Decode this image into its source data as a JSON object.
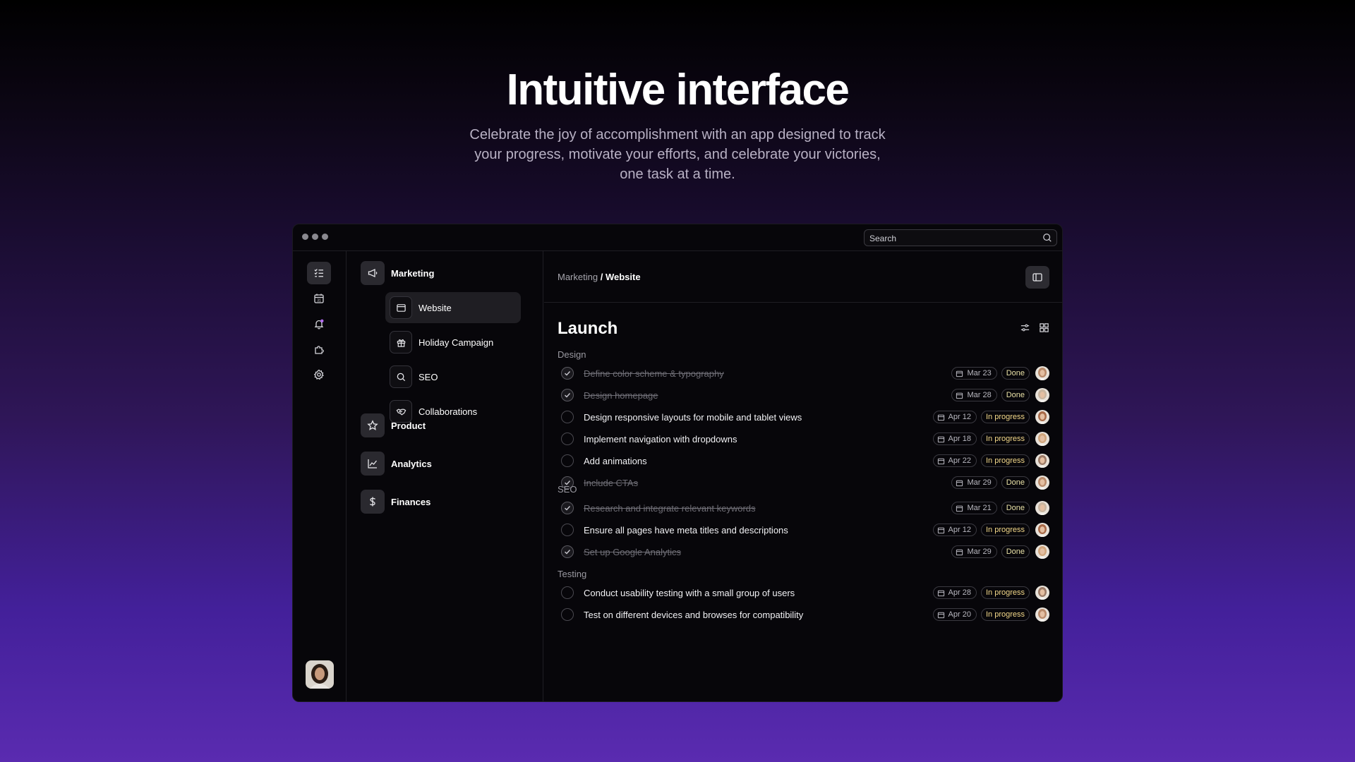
{
  "hero": {
    "title": "Intuitive interface",
    "subtitle": "Celebrate the joy of accomplishment with an app designed to track your progress, motivate your efforts, and celebrate your victories, one task at a time."
  },
  "window": {
    "search": {
      "placeholder": "Search",
      "icon": "search-icon"
    }
  },
  "rail": {
    "items": [
      {
        "icon": "checklist-icon",
        "active": true
      },
      {
        "icon": "calendar-icon",
        "active": false
      },
      {
        "icon": "bell-icon",
        "active": false,
        "badge_color": "#b46cf5"
      },
      {
        "icon": "puzzle-icon",
        "active": false
      },
      {
        "icon": "gear-icon",
        "active": false
      }
    ]
  },
  "nav": {
    "marketing": "Marketing",
    "subitems": [
      "Website",
      "Holiday Campaign",
      "SEO",
      "Collaborations"
    ],
    "product": "Product",
    "analytics": "Analytics",
    "finances": "Finances"
  },
  "main": {
    "breadcrumb": {
      "parent": "Marketing",
      "separator": "/",
      "current": "Website"
    },
    "title": "Launch",
    "sections": [
      {
        "label": "Design",
        "tasks": [
          {
            "title": "Define color scheme & typography",
            "date": "Mar 23",
            "status": "Done",
            "done": true
          },
          {
            "title": "Design homepage",
            "date": "Mar 28",
            "status": "Done",
            "done": true
          },
          {
            "title": "Design responsive layouts for mobile and tablet views",
            "date": "Apr 12",
            "status": "In progress",
            "done": false
          },
          {
            "title": "Implement navigation with dropdowns",
            "date": "Apr 18",
            "status": "In progress",
            "done": false
          },
          {
            "title": "Add animations",
            "date": "Apr 22",
            "status": "In progress",
            "done": false
          },
          {
            "title": "Include CTAs",
            "date": "Mar 29",
            "status": "Done",
            "done": true
          }
        ]
      },
      {
        "label": "SEO",
        "tasks": [
          {
            "title": "Research and integrate relevant keywords",
            "date": "Mar 21",
            "status": "Done",
            "done": true
          },
          {
            "title": "Ensure all pages have meta titles and descriptions",
            "date": "Apr 12",
            "status": "In progress",
            "done": false
          },
          {
            "title": "Set up Google Analytics",
            "date": "Mar 29",
            "status": "Done",
            "done": true
          }
        ]
      },
      {
        "label": "Testing",
        "tasks": [
          {
            "title": "Conduct usability testing with a small group of users",
            "date": "Apr 28",
            "status": "In progress",
            "done": false
          },
          {
            "title": "Test on different devices and browses for compatibility",
            "date": "Apr 20",
            "status": "In progress",
            "done": false
          }
        ]
      }
    ]
  },
  "colors": {
    "status_done": "#e8e0a6",
    "status_in_progress": "#f4d98a",
    "background_top": "#000000",
    "background_bottom": "#5a2bb0"
  }
}
